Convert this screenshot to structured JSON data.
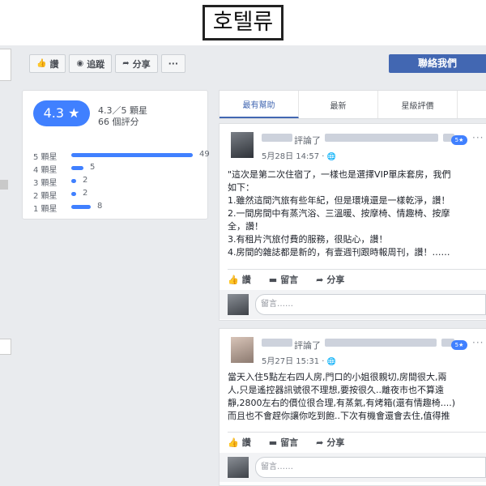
{
  "page_title": "호텔류",
  "action_bar": {
    "like": "讚",
    "follow": "追蹤",
    "share": "分享",
    "more": "···"
  },
  "contact_button": "聯絡我們",
  "rating": {
    "score": "4.3 ★",
    "summary": "4.3／5 顆星",
    "count": "66 個評分",
    "rows": [
      {
        "label": "5 顆星",
        "count": "49",
        "value": 49
      },
      {
        "label": "4 顆星",
        "count": "5",
        "value": 5
      },
      {
        "label": "3 顆星",
        "count": "2",
        "value": 2
      },
      {
        "label": "2 顆星",
        "count": "2",
        "value": 2
      },
      {
        "label": "1 顆星",
        "count": "8",
        "value": 8
      }
    ],
    "max": 49,
    "accent": "#4080ff"
  },
  "tabs": [
    "最有幫助",
    "最新",
    "星級評價"
  ],
  "posts": [
    {
      "reviewed_text": "評論了",
      "stars": "5★",
      "date": "5月28日 14:57 ·",
      "lines": [
        "\"這次是第二次住宿了，一樣也是選擇VIP單床套房，我們",
        "如下：",
        "1.雖然這間汽旅有些年紀，但是環境還是一樣乾淨，讚！",
        "2.一間房間中有蒸汽浴、三溫暖、按摩椅、情趣椅、按摩",
        "全，讚！",
        "3.有租片汽旅付費的服務，很貼心，讚！",
        "4.房間的雜誌都是新的，有壹週刊跟時報周刊，讚！……"
      ],
      "like": "讚",
      "comment": "留言",
      "share": "分享",
      "comment_placeholder": "留言……"
    },
    {
      "reviewed_text": "評論了",
      "stars": "5★",
      "date": "5月27日 15:31 ·",
      "lines": [
        "當天入住5點左右四人房,門口的小姐很親切,房間很大,兩",
        "人,只是遙控器訊號很不理想,要按很久..離夜市也不算遠",
        "靜,2800左右的價位很合理,有蒸氣,有烤箱(還有情趣椅....)",
        "而且也不會趕你讓你吃到飽..下次有機會還會去住,值得推"
      ],
      "like": "讚",
      "comment": "留言",
      "share": "分享",
      "comment_placeholder": "留言……"
    }
  ]
}
